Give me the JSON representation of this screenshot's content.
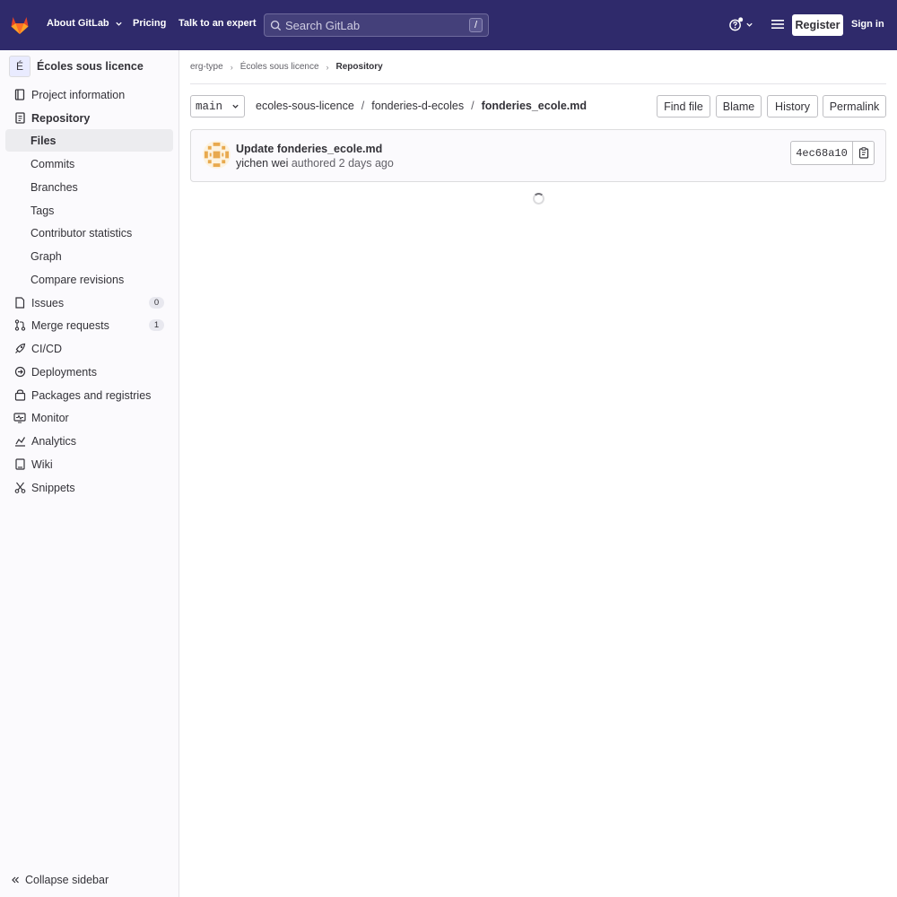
{
  "topbar": {
    "about_label": "About GitLab",
    "pricing_label": "Pricing",
    "expert_label": "Talk to an expert",
    "search_placeholder": "Search GitLab",
    "search_shortcut": "/",
    "register_label": "Register",
    "signin_label": "Sign in"
  },
  "sidebar": {
    "project_initial": "É",
    "project_name": "Écoles sous licence",
    "items": [
      {
        "label": "Project information"
      },
      {
        "label": "Repository"
      },
      {
        "label": "Files"
      },
      {
        "label": "Commits"
      },
      {
        "label": "Branches"
      },
      {
        "label": "Tags"
      },
      {
        "label": "Contributor statistics"
      },
      {
        "label": "Graph"
      },
      {
        "label": "Compare revisions"
      },
      {
        "label": "Issues",
        "count": "0"
      },
      {
        "label": "Merge requests",
        "count": "1"
      },
      {
        "label": "CI/CD"
      },
      {
        "label": "Deployments"
      },
      {
        "label": "Packages and registries"
      },
      {
        "label": "Monitor"
      },
      {
        "label": "Analytics"
      },
      {
        "label": "Wiki"
      },
      {
        "label": "Snippets"
      }
    ],
    "collapse_label": "Collapse sidebar"
  },
  "breadcrumb": {
    "items": [
      "erg-type",
      "Écoles sous licence",
      "Repository"
    ]
  },
  "repo": {
    "branch": "main",
    "path": [
      "ecoles-sous-licence",
      "fonderies-d-ecoles",
      "fonderies_ecole.md"
    ],
    "path_separator": "/",
    "actions": {
      "find_file": "Find file",
      "blame": "Blame",
      "history": "History",
      "permalink": "Permalink"
    }
  },
  "commit": {
    "title": "Update fonderies_ecole.md",
    "author": "yichen wei",
    "meta": " authored 2 days ago",
    "sha": "4ec68a10"
  },
  "colors": {
    "topbar": "#2f2a6b",
    "sidebar_bg": "#fbfafd",
    "active_item": "#ececef"
  }
}
